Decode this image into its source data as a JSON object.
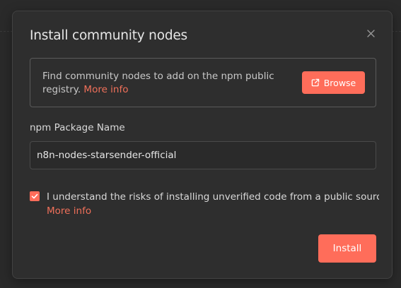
{
  "dialog": {
    "title": "Install community nodes",
    "close_icon": "close-icon"
  },
  "info": {
    "text": "Find community nodes to add on the npm public registry.",
    "more_info_link": "More info",
    "browse_label": "Browse",
    "browse_icon": "external-link-icon"
  },
  "package_field": {
    "label": "npm Package Name",
    "value": "n8n-nodes-starsender-official"
  },
  "consent": {
    "checked": true,
    "text": "I understand the risks of installing unverified code from a public source",
    "more_info_link": "More info"
  },
  "actions": {
    "install_label": "Install"
  },
  "colors": {
    "accent": "#ff6d5a",
    "link": "#f0705a",
    "modal_bg": "#2e2e2e",
    "text": "#e6e6e6"
  }
}
